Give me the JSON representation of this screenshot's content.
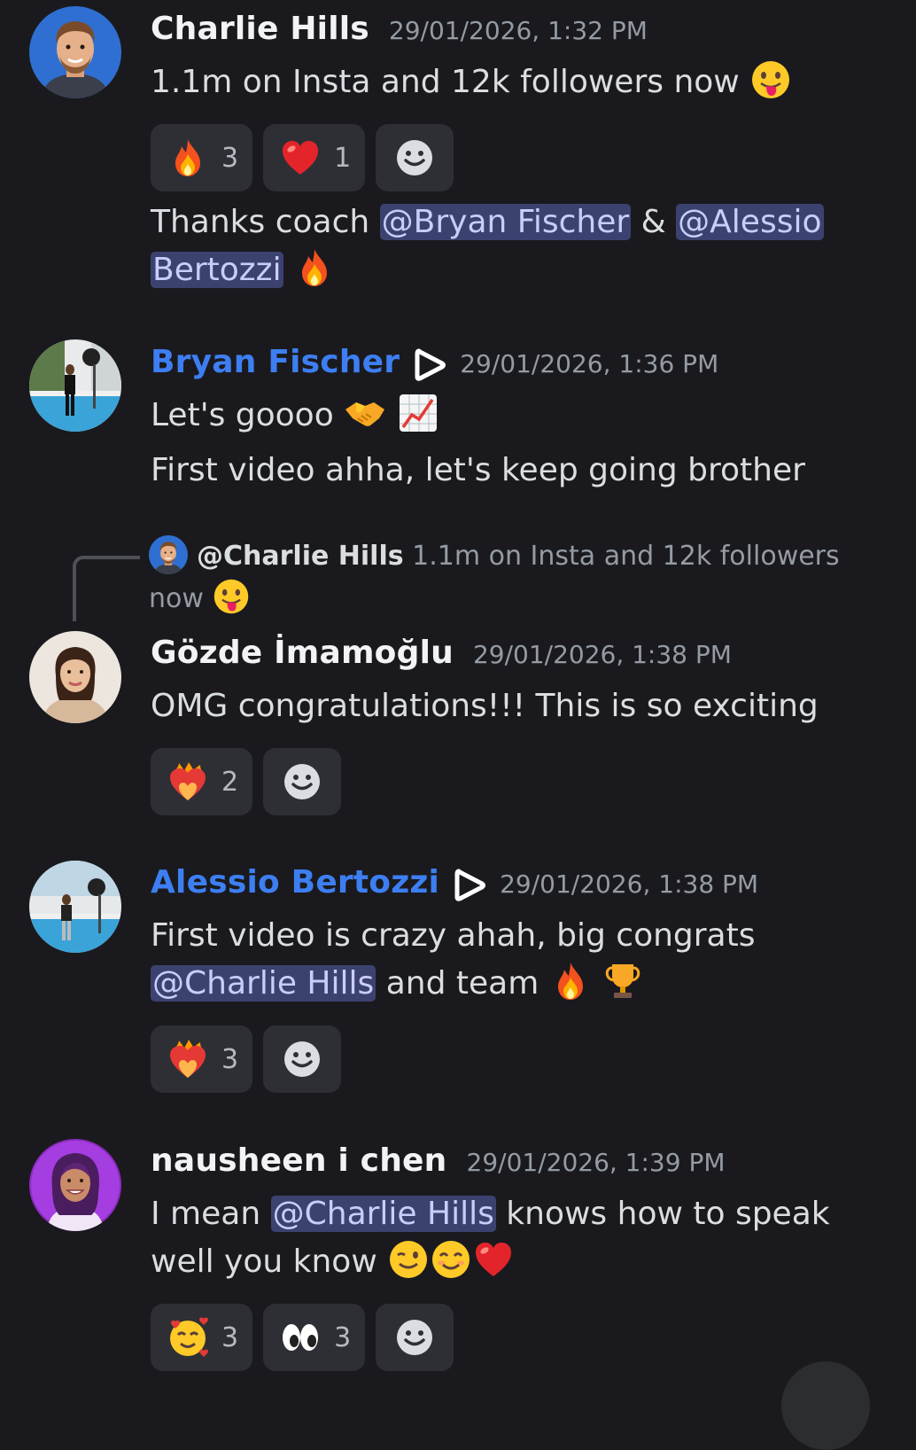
{
  "colors": {
    "background": "#1a1a1e",
    "mention_bg": "#3c4270",
    "mention_text": "#c9cdfb",
    "username_accent": "#3d7ff2",
    "timestamp": "#949ba4",
    "reaction_bg": "#2e2f35"
  },
  "messages": [
    {
      "author": "Charlie Hills",
      "timestamp": "29/01/2026, 1:32 PM",
      "avatar": "charlie-avatar",
      "line1": "1.1m on Insta and 12k followers now",
      "line1_emoji": "face-with-tongue",
      "reactions": [
        {
          "emoji": "fire",
          "count": "3"
        },
        {
          "emoji": "red-heart",
          "count": "1"
        }
      ],
      "line2_prefix": "Thanks coach ",
      "line2_mention1": "@Bryan Fischer",
      "line2_amp": " & ",
      "line2_mention2a": "@Alessio",
      "line2_mention2b": "Bertozzi",
      "line2_emoji": "fire"
    },
    {
      "author": "Bryan Fischer",
      "timestamp": "29/01/2026, 1:36 PM",
      "avatar": "bryan-avatar",
      "role_icon": "play-badge-icon",
      "line1": "Let's goooo",
      "line1_emojis": [
        "handshake",
        "chart-increasing"
      ],
      "line2": "First video ahha, let's keep going brother"
    },
    {
      "author": "Gözde İmamoğlu",
      "timestamp": "29/01/2026, 1:38 PM",
      "avatar": "gozde-avatar",
      "reply": {
        "name": "@Charlie Hills",
        "text": "1.1m on Insta and 12k followers",
        "text2": "now",
        "emoji": "face-with-tongue"
      },
      "line1": "OMG congratulations!!! This is so exciting",
      "reactions": [
        {
          "emoji": "heart-on-fire",
          "count": "2"
        }
      ]
    },
    {
      "author": "Alessio Bertozzi",
      "timestamp": "29/01/2026, 1:38 PM",
      "avatar": "alessio-avatar",
      "role_icon": "play-badge-icon",
      "line1": "First video is crazy ahah, big congrats",
      "line2_mention": "@Charlie Hills",
      "line2_text": " and team ",
      "line2_emojis": [
        "fire",
        "trophy"
      ],
      "reactions": [
        {
          "emoji": "heart-on-fire",
          "count": "3"
        }
      ]
    },
    {
      "author": "nausheen i chen",
      "timestamp": "29/01/2026, 1:39 PM",
      "avatar": "nausheen-avatar",
      "line1_prefix": "I mean ",
      "line1_mention": "@Charlie Hills",
      "line1_suffix": " knows how to speak",
      "line2": "well you know ",
      "line2_emojis": [
        "winking-face",
        "smiling-face",
        "red-heart"
      ],
      "reactions": [
        {
          "emoji": "smiling-face-with-hearts",
          "count": "3"
        },
        {
          "emoji": "eyes",
          "count": "3"
        }
      ]
    }
  ]
}
